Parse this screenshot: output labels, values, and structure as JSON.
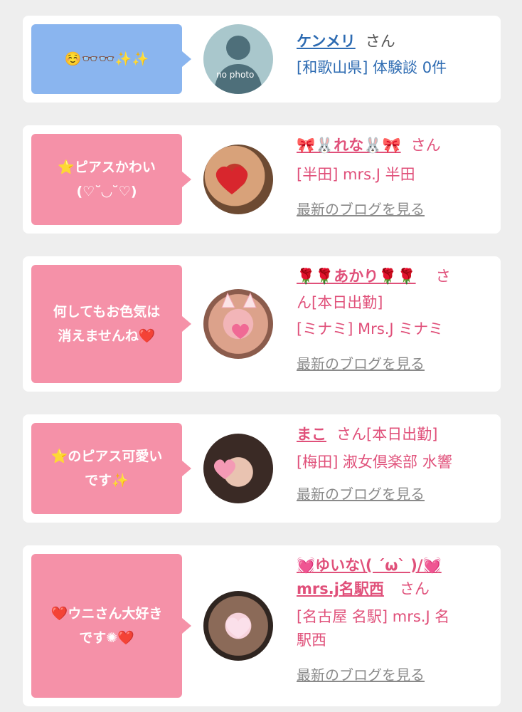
{
  "cards": [
    {
      "message": "☺️👓👓✨✨",
      "name": "ケンメリ",
      "honorific": "さん",
      "line2": "[和歌山県] 体験談 0件",
      "avatar_text": "no photo"
    },
    {
      "message_line1": "⭐ピアスかわい",
      "message_line2": "(♡˘◡˘♡)",
      "name": "🎀🐰れな🐰🎀",
      "honorific": "さん",
      "line2": "[半田] mrs.J 半田",
      "blog_link": "最新のブログを見る"
    },
    {
      "message_line1": "何してもお色気は",
      "message_line2": "消えませんね❤️",
      "name": "🌹🌹あかり🌹🌹",
      "honorific": "さ",
      "line2": "ん[本日出勤]",
      "line3": "[ミナミ] Mrs.J ミナミ",
      "blog_link": "最新のブログを見る"
    },
    {
      "message_line1": "⭐のピアス可愛い",
      "message_line2": "です✨",
      "name": "まこ",
      "honorific": "さん[本日出勤]",
      "line2": "[梅田] 淑女倶楽部 水響",
      "blog_link": "最新のブログを見る"
    },
    {
      "message_line1": "❤️ウニさん大好き",
      "message_line2": "です✺❤️",
      "name_line1": "💓ゆいな\\( ´ω` )/💓",
      "name_line2": "mrs.j名駅西",
      "honorific": "さん",
      "line2": "[名古屋 名駅] mrs.J 名",
      "line3": "駅西",
      "blog_link": "最新のブログを見る"
    }
  ],
  "colors": {
    "blue_bubble": "#8ab5ef",
    "pink_bubble": "#f591a8",
    "blue_text": "#2d6bb2",
    "pink_text": "#e0507a"
  }
}
